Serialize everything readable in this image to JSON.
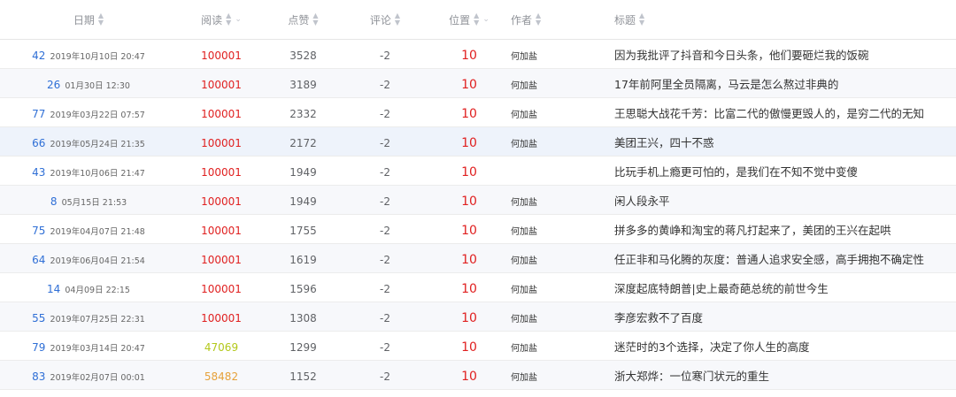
{
  "headers": {
    "date": "日期",
    "read": "阅读",
    "like": "点赞",
    "comment": "评论",
    "position": "位置",
    "author": "作者",
    "title": "标题"
  },
  "colors": {
    "red": "#e02020",
    "yellow_green": "#b3c81a",
    "orange": "#e6a13a",
    "id_blue": "#2f6fd6",
    "sort_active": "#3a8ee6"
  },
  "rows": [
    {
      "id": "42",
      "time": "2019年10月10日 20:47",
      "read": "100001",
      "read_color": "#e02020",
      "like": "3528",
      "comment": "-2",
      "position": "10",
      "author": "何加盐",
      "title": "因为我批评了抖音和今日头条，他们要砸烂我的饭碗"
    },
    {
      "id": "26",
      "time": "01月30日 12:30",
      "read": "100001",
      "read_color": "#e02020",
      "like": "3189",
      "comment": "-2",
      "position": "10",
      "author": "何加盐",
      "title": "17年前阿里全员隔离，马云是怎么熬过非典的"
    },
    {
      "id": "77",
      "time": "2019年03月22日 07:57",
      "read": "100001",
      "read_color": "#e02020",
      "like": "2332",
      "comment": "-2",
      "position": "10",
      "author": "何加盐",
      "title": "王思聪大战花千芳：比富二代的傲慢更毁人的，是穷二代的无知"
    },
    {
      "id": "66",
      "time": "2019年05月24日 21:35",
      "read": "100001",
      "read_color": "#e02020",
      "like": "2172",
      "comment": "-2",
      "position": "10",
      "author": "何加盐",
      "title": "美团王兴，四十不惑"
    },
    {
      "id": "43",
      "time": "2019年10月06日 21:47",
      "read": "100001",
      "read_color": "#e02020",
      "like": "1949",
      "comment": "-2",
      "position": "10",
      "author": "",
      "title": "比玩手机上瘾更可怕的，是我们在不知不觉中变傻"
    },
    {
      "id": "8",
      "time": "05月15日 21:53",
      "read": "100001",
      "read_color": "#e02020",
      "like": "1949",
      "comment": "-2",
      "position": "10",
      "author": "何加盐",
      "title": "闲人段永平"
    },
    {
      "id": "75",
      "time": "2019年04月07日 21:48",
      "read": "100001",
      "read_color": "#e02020",
      "like": "1755",
      "comment": "-2",
      "position": "10",
      "author": "何加盐",
      "title": "拼多多的黄峥和淘宝的蒋凡打起来了，美团的王兴在起哄"
    },
    {
      "id": "64",
      "time": "2019年06月04日 21:54",
      "read": "100001",
      "read_color": "#e02020",
      "like": "1619",
      "comment": "-2",
      "position": "10",
      "author": "何加盐",
      "title": "任正非和马化腾的灰度：普通人追求安全感，高手拥抱不确定性"
    },
    {
      "id": "14",
      "time": "04月09日 22:15",
      "read": "100001",
      "read_color": "#e02020",
      "like": "1596",
      "comment": "-2",
      "position": "10",
      "author": "何加盐",
      "title": "深度起底特朗普|史上最奇葩总统的前世今生"
    },
    {
      "id": "55",
      "time": "2019年07月25日 22:31",
      "read": "100001",
      "read_color": "#e02020",
      "like": "1308",
      "comment": "-2",
      "position": "10",
      "author": "何加盐",
      "title": "李彦宏救不了百度"
    },
    {
      "id": "79",
      "time": "2019年03月14日 20:47",
      "read": "47069",
      "read_color": "#b3c81a",
      "like": "1299",
      "comment": "-2",
      "position": "10",
      "author": "何加盐",
      "title": "迷茫时的3个选择，决定了你人生的高度"
    },
    {
      "id": "83",
      "time": "2019年02月07日 00:01",
      "read": "58482",
      "read_color": "#e6a13a",
      "like": "1152",
      "comment": "-2",
      "position": "10",
      "author": "何加盐",
      "title": "浙大郑烨：一位寒门状元的重生"
    }
  ]
}
